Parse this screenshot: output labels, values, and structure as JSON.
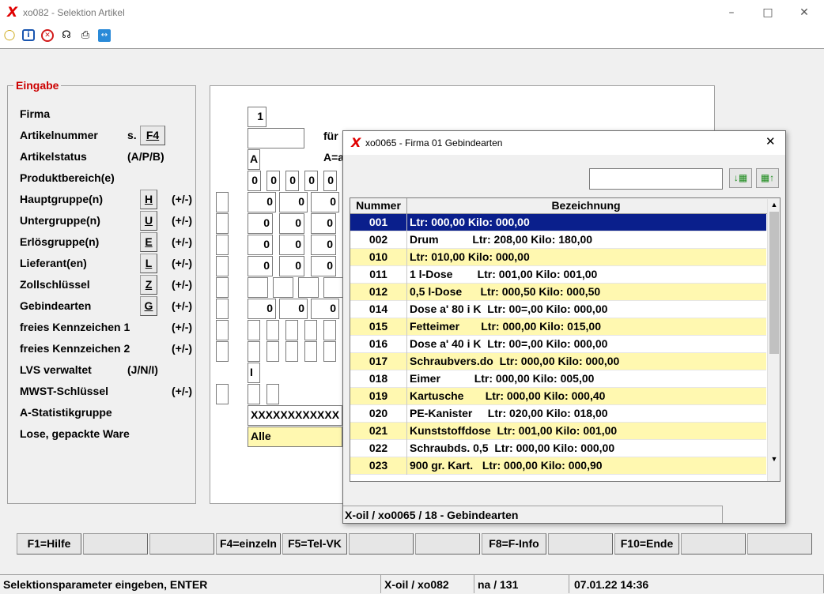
{
  "window": {
    "title": "xo082 - Selektion Artikel",
    "logo": "X"
  },
  "toolbar_icons": [
    "lightbulb-icon",
    "info-icon",
    "cancel-icon",
    "headset-icon",
    "printer-icon",
    "remote-icon"
  ],
  "form": {
    "group_title": "Eingabe",
    "rows": [
      {
        "label": "Firma",
        "hint": "",
        "button": ""
      },
      {
        "label": "Artikelnummer",
        "hint": "s.",
        "button": "F4"
      },
      {
        "label": "Artikelstatus",
        "hint": "(A/P/B)",
        "button": ""
      },
      {
        "label": "Produktbereich(e)",
        "hint": "",
        "button": ""
      },
      {
        "label": "Hauptgruppe(n)",
        "hint": "(+/-)",
        "button": "H"
      },
      {
        "label": "Untergruppe(n)",
        "hint": "(+/-)",
        "button": "U"
      },
      {
        "label": "Erlösgruppe(n)",
        "hint": "(+/-)",
        "button": "E"
      },
      {
        "label": "Lieferant(en)",
        "hint": "(+/-)",
        "button": "L"
      },
      {
        "label": "Zollschlüssel",
        "hint": "(+/-)",
        "button": "Z"
      },
      {
        "label": "Gebindearten",
        "hint": "(+/-)",
        "button": "G"
      },
      {
        "label": "freies Kennzeichen 1",
        "hint": "(+/-)",
        "button": ""
      },
      {
        "label": "freies Kennzeichen 2",
        "hint": "(+/-)",
        "button": ""
      },
      {
        "label": "LVS verwaltet",
        "hint": "(J/N/I)",
        "button": ""
      },
      {
        "label": "MWST-Schlüssel",
        "hint": "(+/-)",
        "button": ""
      },
      {
        "label": "A-Statistikgruppe",
        "hint": "",
        "button": ""
      },
      {
        "label": "Lose, gepackte Ware",
        "hint": "",
        "button": ""
      }
    ],
    "values": {
      "firma": "1",
      "fuer_label": "für",
      "status": "A",
      "status_hint": "A=a",
      "zero": "0",
      "lvs": "I",
      "statistik": "XXXXXXXXXXXX",
      "lose": "Alle"
    }
  },
  "popup": {
    "logo": "X",
    "title": "xo0065 - Firma 01 Gebindearten",
    "search_value": "",
    "sort_down_icon": "sort-down-icon",
    "sort_up_icon": "sort-up-icon",
    "columns": [
      "Nummer",
      "Bezeichnung"
    ],
    "rows": [
      {
        "nr": "001",
        "text": "Ltr: 000,00 Kilo: 000,00"
      },
      {
        "nr": "002",
        "text": "Drum           Ltr: 208,00 Kilo: 180,00"
      },
      {
        "nr": "010",
        "text": "Ltr: 010,00 Kilo: 000,00"
      },
      {
        "nr": "011",
        "text": "1 l-Dose        Ltr: 001,00 Kilo: 001,00"
      },
      {
        "nr": "012",
        "text": "0,5 l-Dose      Ltr: 000,50 Kilo: 000,50"
      },
      {
        "nr": "014",
        "text": "Dose a' 80 i K  Ltr: 00=,00 Kilo: 000,00"
      },
      {
        "nr": "015",
        "text": "Fetteimer       Ltr: 000,00 Kilo: 015,00"
      },
      {
        "nr": "016",
        "text": "Dose a' 40 i K  Ltr: 00=,00 Kilo: 000,00"
      },
      {
        "nr": "017",
        "text": "Schraubvers.do  Ltr: 000,00 Kilo: 000,00"
      },
      {
        "nr": "018",
        "text": "Eimer           Ltr: 000,00 Kilo: 005,00"
      },
      {
        "nr": "019",
        "text": "Kartusche       Ltr: 000,00 Kilo: 000,40"
      },
      {
        "nr": "020",
        "text": "PE-Kanister     Ltr: 020,00 Kilo: 018,00"
      },
      {
        "nr": "021",
        "text": "Kunststoffdose  Ltr: 001,00 Kilo: 001,00"
      },
      {
        "nr": "022",
        "text": "Schraubds. 0,5  Ltr: 000,00 Kilo: 000,00"
      },
      {
        "nr": "023",
        "text": "900 gr. Kart.   Ltr: 000,00 Kilo: 000,90"
      }
    ],
    "status": "X-oil / xo0065 / 18 - Gebindearten"
  },
  "fkeys": [
    "F1=Hilfe",
    "",
    "",
    "F4=einzeln",
    "F5=Tel-VK",
    "",
    "",
    "F8=F-Info",
    "",
    "F10=Ende",
    "",
    ""
  ],
  "statusbar": {
    "message": "Selektionsparameter eingeben, ENTER",
    "program": "X-oil / xo082",
    "counter": "na / 131",
    "datetime": "07.01.22 14:36"
  }
}
